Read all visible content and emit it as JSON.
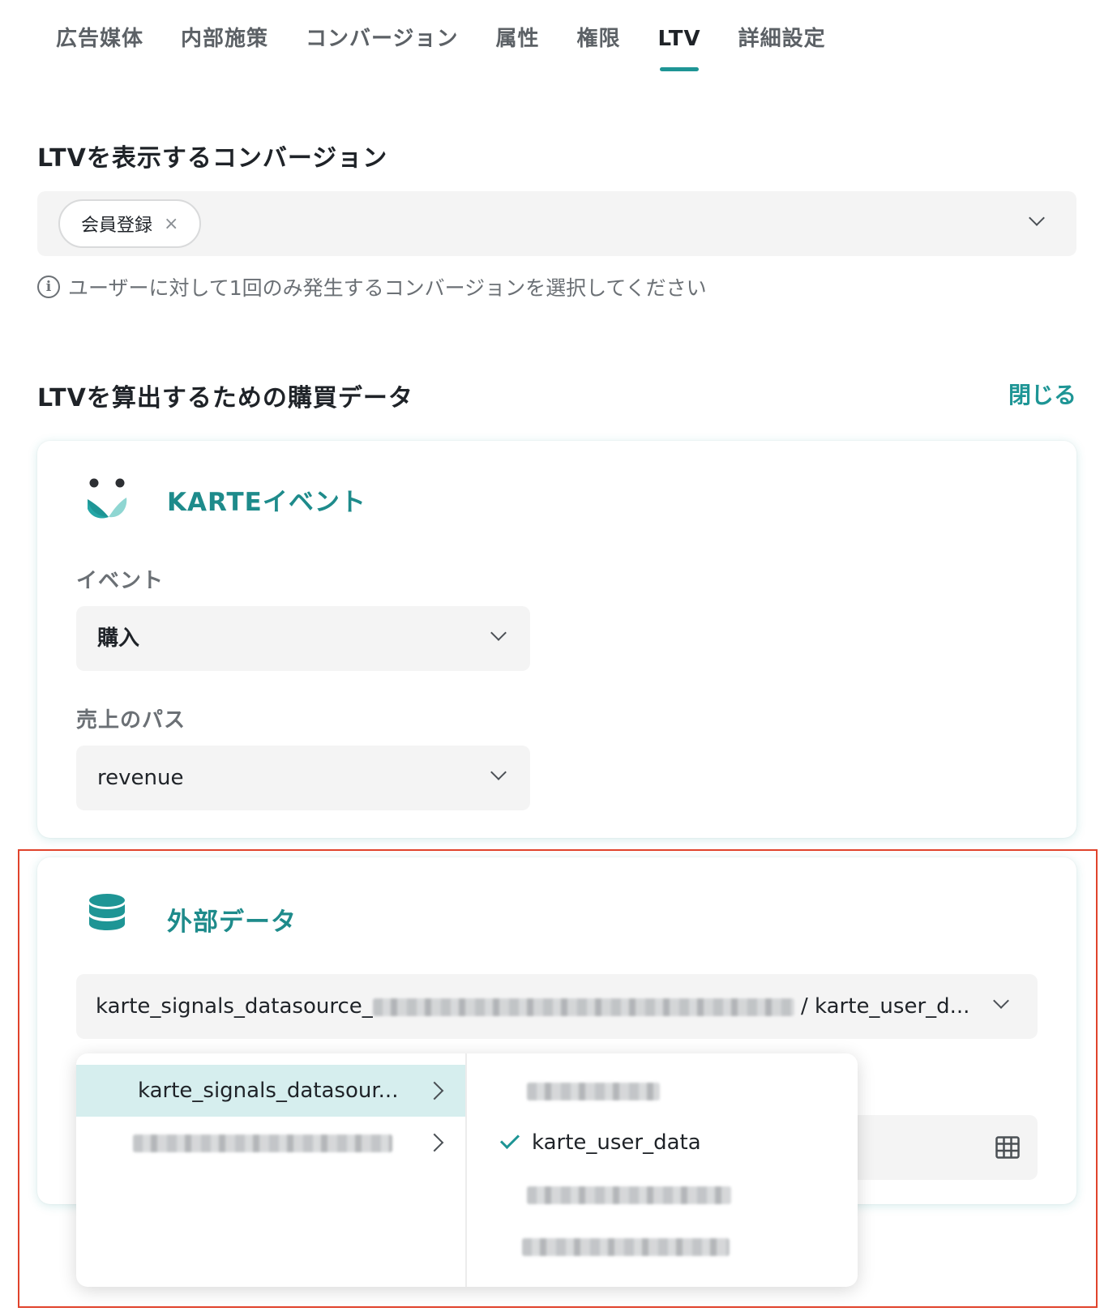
{
  "tabs": [
    {
      "label": "広告媒体"
    },
    {
      "label": "内部施策"
    },
    {
      "label": "コンバージョン"
    },
    {
      "label": "属性"
    },
    {
      "label": "権限"
    },
    {
      "label": "LTV",
      "active": true
    },
    {
      "label": "詳細設定"
    }
  ],
  "ltv_conversion": {
    "title": "LTVを表示するコンバージョン",
    "selected_chip": "会員登録",
    "chip_remove": "×",
    "hint": "ユーザーに対して1回のみ発生するコンバージョンを選択してください",
    "info_glyph": "i"
  },
  "purchase_data": {
    "title": "LTVを算出するための購買データ",
    "close_label": "閉じる"
  },
  "karte_event_card": {
    "title": "KARTEイベント",
    "event_label": "イベント",
    "event_value": "購入",
    "path_label": "売上のパス",
    "path_value": "revenue"
  },
  "external_data_card": {
    "title": "外部データ",
    "select_prefix": "karte_signals_datasource_",
    "select_suffix": "/ karte_user_d...",
    "dropdown": {
      "datasets": [
        {
          "label": "karte_signals_datasour...",
          "active": true
        },
        {
          "label": "",
          "blurred": true
        }
      ],
      "tables": [
        {
          "label": "",
          "blurred": true
        },
        {
          "label": "karte_user_data",
          "checked": true
        },
        {
          "label": "",
          "blurred": true
        },
        {
          "label": "",
          "blurred": true
        }
      ]
    }
  },
  "colors": {
    "accent": "#1e9595",
    "highlight_frame": "#e0432c"
  }
}
